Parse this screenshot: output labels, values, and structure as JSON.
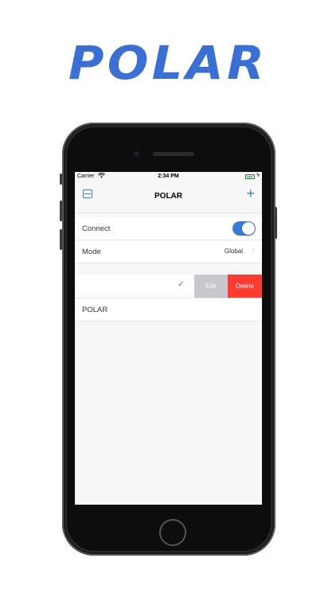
{
  "brand": {
    "logo_text": "POLAR",
    "accent_color": "#3a6fd6"
  },
  "status_bar": {
    "carrier": "Carrier",
    "wifi_icon": "wifi-icon",
    "time": "2:34 PM",
    "battery_icon": "battery-icon"
  },
  "nav": {
    "title": "POLAR",
    "left_icon": "list-icon",
    "right_icon": "plus-icon",
    "plus_glyph": "+"
  },
  "settings": {
    "connect_label": "Connect",
    "connect_on": true,
    "mode_label": "Mode",
    "mode_value": "Global",
    "chevron": "›"
  },
  "servers": {
    "swipe_row": {
      "check_glyph": "✓",
      "edit_label": "Edit",
      "delete_label": "Delete"
    },
    "items": [
      {
        "label": "POLAR"
      }
    ]
  },
  "colors": {
    "accent": "#3a7bd5",
    "delete": "#ff3b30",
    "edit": "#c7c7cc"
  }
}
